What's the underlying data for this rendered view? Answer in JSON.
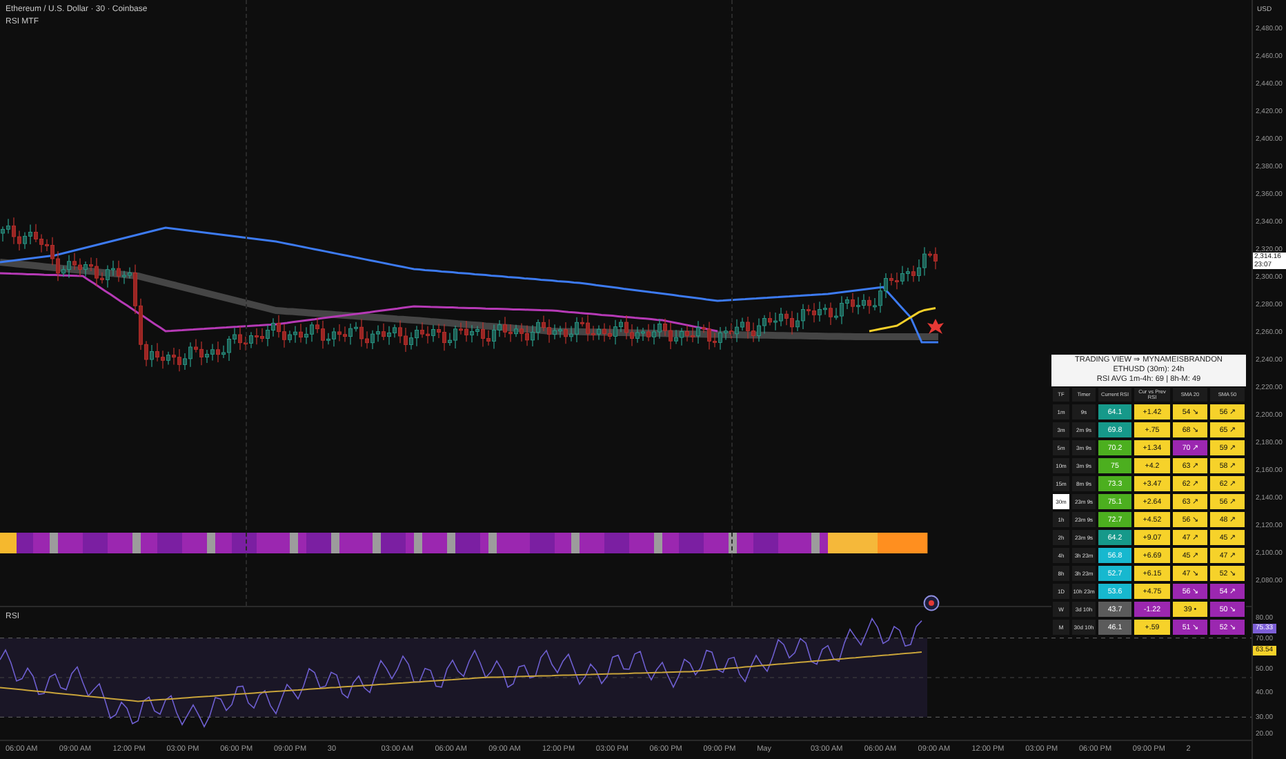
{
  "legend": {
    "symbol": "Ethereum / U.S. Dollar · 30 · Coinbase",
    "indicator": "RSI MTF"
  },
  "price_axis": {
    "currency": "USD",
    "labels": [
      "2,480.00",
      "2,460.00",
      "2,440.00",
      "2,420.00",
      "2,400.00",
      "2,380.00",
      "2,360.00",
      "2,340.00",
      "2,320.00",
      "2,300.00",
      "2,280.00",
      "2,260.00",
      "2,240.00",
      "2,220.00",
      "2,200.00",
      "2,180.00",
      "2,160.00",
      "2,140.00",
      "2,120.00",
      "2,100.00",
      "2,080.00"
    ],
    "price_tag": "2,314.16",
    "countdown": "23:07"
  },
  "rsi_table": {
    "title": "TRADING VIEW ⇒ MYNAMEISBRANDON",
    "subtitle": "ETHUSD (30m): 24h",
    "average": "RSI AVG 1m-4h: 69 | 8h-M: 49",
    "columns": [
      "TF",
      "Timer",
      "Current RSI",
      "Cur vs Prev RSI",
      "SMA 20",
      "SMA 50"
    ],
    "rows": [
      {
        "selected": false,
        "cells": [
          {
            "text": "1m"
          },
          {
            "text": "9s"
          },
          {
            "text": "64.1",
            "color": "#16998a"
          },
          {
            "text": "+1.42",
            "color": "#f6d22a"
          },
          {
            "text": "54 ↘",
            "color": "#f6d22a"
          },
          {
            "text": "56 ↗",
            "color": "#f6d22a"
          }
        ]
      },
      {
        "selected": false,
        "cells": [
          {
            "text": "3m"
          },
          {
            "text": "2m 9s"
          },
          {
            "text": "69.8",
            "color": "#16998a"
          },
          {
            "text": "+.75",
            "color": "#f6d22a"
          },
          {
            "text": "68 ↘",
            "color": "#f6d22a"
          },
          {
            "text": "65 ↗",
            "color": "#f6d22a"
          }
        ]
      },
      {
        "selected": false,
        "cells": [
          {
            "text": "5m"
          },
          {
            "text": "3m 9s"
          },
          {
            "text": "70.2",
            "color": "#4caf1f"
          },
          {
            "text": "+1.34",
            "color": "#f6d22a"
          },
          {
            "text": "70 ↗",
            "color": "#9b27b0"
          },
          {
            "text": "59 ↗",
            "color": "#f6d22a"
          }
        ]
      },
      {
        "selected": false,
        "cells": [
          {
            "text": "10m"
          },
          {
            "text": "3m 9s"
          },
          {
            "text": "75",
            "color": "#4caf1f"
          },
          {
            "text": "+4.2",
            "color": "#f6d22a"
          },
          {
            "text": "63 ↗",
            "color": "#f6d22a"
          },
          {
            "text": "58 ↗",
            "color": "#f6d22a"
          }
        ]
      },
      {
        "selected": false,
        "cells": [
          {
            "text": "15m"
          },
          {
            "text": "8m 9s"
          },
          {
            "text": "73.3",
            "color": "#4caf1f"
          },
          {
            "text": "+3.47",
            "color": "#f6d22a"
          },
          {
            "text": "62 ↗",
            "color": "#f6d22a"
          },
          {
            "text": "62 ↗",
            "color": "#f6d22a"
          }
        ]
      },
      {
        "selected": true,
        "cells": [
          {
            "text": "30m"
          },
          {
            "text": "23m 9s"
          },
          {
            "text": "75.1",
            "color": "#4caf1f"
          },
          {
            "text": "+2.64",
            "color": "#f6d22a"
          },
          {
            "text": "63 ↗",
            "color": "#f6d22a"
          },
          {
            "text": "56 ↗",
            "color": "#f6d22a"
          }
        ]
      },
      {
        "selected": false,
        "cells": [
          {
            "text": "1h"
          },
          {
            "text": "23m 9s"
          },
          {
            "text": "72.7",
            "color": "#4caf1f"
          },
          {
            "text": "+4.52",
            "color": "#f6d22a"
          },
          {
            "text": "56 ↘",
            "color": "#f6d22a"
          },
          {
            "text": "48 ↗",
            "color": "#f6d22a"
          }
        ]
      },
      {
        "selected": false,
        "cells": [
          {
            "text": "2h"
          },
          {
            "text": "23m 9s"
          },
          {
            "text": "64.2",
            "color": "#16998a"
          },
          {
            "text": "+9.07",
            "color": "#f6d22a"
          },
          {
            "text": "47 ↗",
            "color": "#f6d22a"
          },
          {
            "text": "45 ↗",
            "color": "#f6d22a"
          }
        ]
      },
      {
        "selected": false,
        "cells": [
          {
            "text": "4h"
          },
          {
            "text": "3h 23m"
          },
          {
            "text": "56.8",
            "color": "#17b8cf"
          },
          {
            "text": "+6.69",
            "color": "#f6d22a"
          },
          {
            "text": "45 ↗",
            "color": "#f6d22a"
          },
          {
            "text": "47 ↗",
            "color": "#f6d22a"
          }
        ]
      },
      {
        "selected": false,
        "cells": [
          {
            "text": "8h"
          },
          {
            "text": "3h 23m"
          },
          {
            "text": "52.7",
            "color": "#17b8cf"
          },
          {
            "text": "+6.15",
            "color": "#f6d22a"
          },
          {
            "text": "47 ↘",
            "color": "#f6d22a"
          },
          {
            "text": "52 ↘",
            "color": "#f6d22a"
          }
        ]
      },
      {
        "selected": false,
        "cells": [
          {
            "text": "1D"
          },
          {
            "text": "10h 23m"
          },
          {
            "text": "53.6",
            "color": "#17b8cf"
          },
          {
            "text": "+4.75",
            "color": "#f6d22a"
          },
          {
            "text": "56 ↘",
            "color": "#9b27b0"
          },
          {
            "text": "54 ↗",
            "color": "#9b27b0"
          }
        ]
      },
      {
        "selected": false,
        "cells": [
          {
            "text": "W"
          },
          {
            "text": "3d 10h"
          },
          {
            "text": "43.7",
            "color": "#5b5b5b"
          },
          {
            "text": "-1.22",
            "color": "#9b27b0"
          },
          {
            "text": "39 •",
            "color": "#f6d22a"
          },
          {
            "text": "50 ↘",
            "color": "#9b27b0"
          }
        ]
      },
      {
        "selected": false,
        "cells": [
          {
            "text": "M"
          },
          {
            "text": "30d 10h"
          },
          {
            "text": "46.1",
            "color": "#5b5b5b"
          },
          {
            "text": "+.59",
            "color": "#f6d22a"
          },
          {
            "text": "51 ↘",
            "color": "#9b27b0"
          },
          {
            "text": "52 ↘",
            "color": "#9b27b0"
          }
        ]
      }
    ]
  },
  "rsi_pane": {
    "title": "RSI",
    "labels": [
      "80.00",
      "70.00",
      "50.00",
      "40.00",
      "30.00",
      "20.00"
    ],
    "rsi_tag": "75.33",
    "sma_tag": "63.54"
  },
  "time_axis": {
    "labels": [
      "06:00 AM",
      "09:00 AM",
      "12:00 PM",
      "03:00 PM",
      "06:00 PM",
      "09:00 PM",
      "30",
      "03:00 AM",
      "06:00 AM",
      "09:00 AM",
      "12:00 PM",
      "03:00 PM",
      "06:00 PM",
      "09:00 PM",
      "May",
      "03:00 AM",
      "06:00 AM",
      "09:00 AM",
      "12:00 PM",
      "03:00 PM",
      "06:00 PM",
      "09:00 PM",
      "2"
    ]
  }
}
